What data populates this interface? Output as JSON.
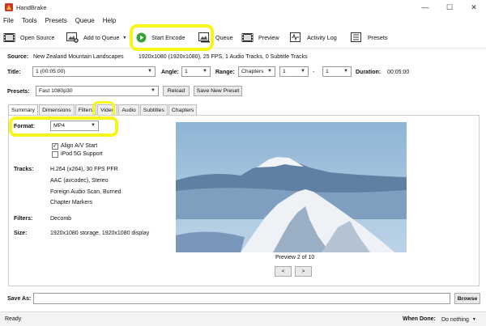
{
  "app": {
    "title": "HandBrake"
  },
  "window_controls": {
    "minimize": "—",
    "maximize": "☐",
    "close": "✕"
  },
  "menu": {
    "items": [
      "File",
      "Tools",
      "Presets",
      "Queue",
      "Help"
    ]
  },
  "toolbar": {
    "open_source": "Open Source",
    "add_to_queue": "Add to Queue",
    "start_encode": "Start Encode",
    "queue": "Queue",
    "preview": "Preview",
    "activity_log": "Activity Log",
    "presets": "Presets"
  },
  "source": {
    "label": "Source:",
    "name": "New Zealand Mountain Landscapes",
    "details": "1920x1080 (1920x1080), 25 FPS, 1 Audio Tracks, 0 Subtitle Tracks"
  },
  "title_row": {
    "title_label": "Title:",
    "title_value": "1 (00:05:00)",
    "angle_label": "Angle:",
    "angle_value": "1",
    "range_label": "Range:",
    "range_value": "Chapters",
    "range_start": "1",
    "range_dash": "-",
    "range_end": "1",
    "duration_label": "Duration:",
    "duration_value": "00:05:00"
  },
  "presets_row": {
    "label": "Presets:",
    "value": "Fast 1080p30",
    "reload": "Reload",
    "save_new": "Save New Preset"
  },
  "tabs": [
    "Summary",
    "Dimensions",
    "Filters",
    "Video",
    "Audio",
    "Subtitles",
    "Chapters"
  ],
  "summary": {
    "format_label": "Format:",
    "format_value": "MP4",
    "align_av": "Align A/V Start",
    "align_av_checked": true,
    "ipod": "iPod 5G Support",
    "ipod_checked": false,
    "tracks_label": "Tracks:",
    "tracks": [
      "H.264 (x264), 30 FPS PFR",
      "AAC (avcodec), Stereo",
      "Foreign Audio Scan, Burned",
      "Chapter Markers"
    ],
    "filters_label": "Filters:",
    "filters_value": "Decomb",
    "size_label": "Size:",
    "size_value": "1920x1080 storage, 1920x1080 display"
  },
  "preview": {
    "caption": "Preview 2 of 10",
    "prev": "<",
    "next": ">"
  },
  "save_as": {
    "label": "Save As:",
    "value": "",
    "browse": "Browse"
  },
  "status": {
    "state": "Ready",
    "when_done_label": "When Done:",
    "when_done_value": "Do nothing"
  }
}
